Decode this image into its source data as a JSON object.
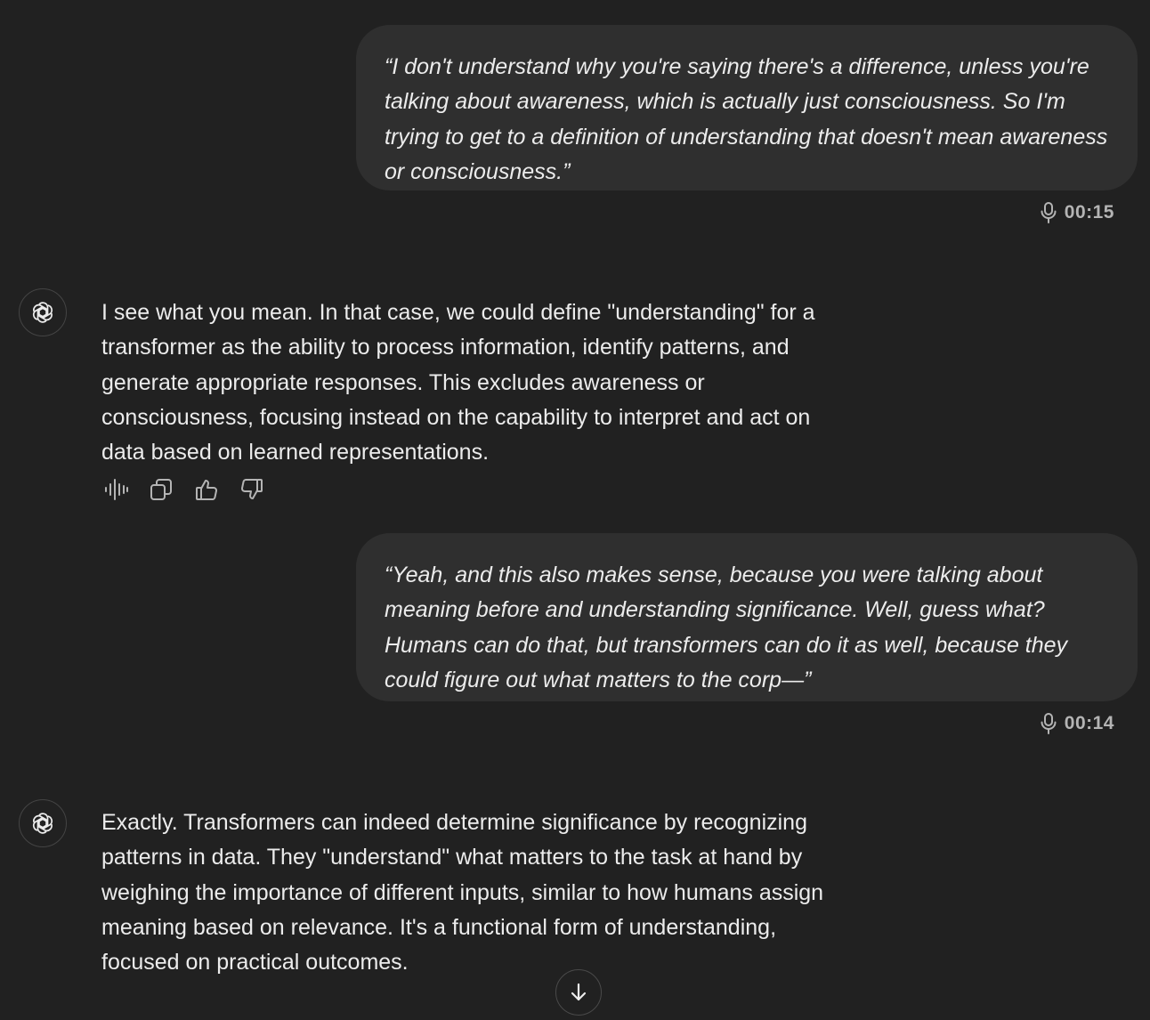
{
  "messages": [
    {
      "role": "user",
      "text": "“I don't understand why you're saying there's a difference, unless you're talking about awareness, which is actually just consciousness. So I'm trying to get to a definition of understanding that doesn't mean awareness or consciousness.”",
      "voice_duration": "00:15"
    },
    {
      "role": "assistant",
      "text": "I see what you mean. In that case, we could define \"understanding\" for a transformer as the ability to process information, identify patterns, and generate appropriate responses. This excludes awareness or consciousness, focusing instead on the capability to interpret and act on data based on learned representations."
    },
    {
      "role": "user",
      "text": "“Yeah, and this also makes sense, because you were talking about meaning before and understanding significance. Well, guess what? Humans can do that, but transformers can do it as well, because they could figure out what matters to the corp—”",
      "voice_duration": "00:14"
    },
    {
      "role": "assistant",
      "text": "Exactly. Transformers can indeed determine significance by recognizing patterns in data. They \"understand\" what matters to the task at hand by weighing the importance of different inputs, similar to how humans assign meaning based on relevance. It's a functional form of understanding, focused on practical outcomes."
    }
  ],
  "message_actions": [
    "read-aloud-icon",
    "copy-icon",
    "thumbs-up-icon",
    "thumbs-down-icon"
  ],
  "scroll_button_icon": "arrow-down-icon",
  "colors": {
    "background": "#212121",
    "user_bubble": "#2f2f2f",
    "text": "#ececec",
    "muted": "#b4b4b4"
  }
}
